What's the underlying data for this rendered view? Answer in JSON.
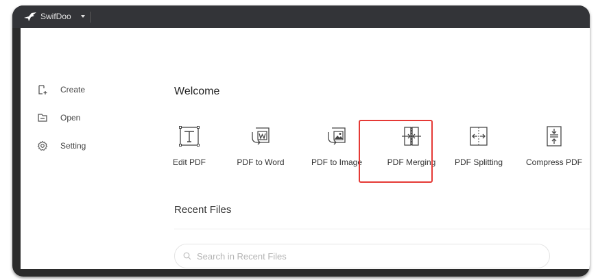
{
  "app": {
    "name": "SwifDoo"
  },
  "sidebar": {
    "items": [
      {
        "label": "Create",
        "icon": "create-icon"
      },
      {
        "label": "Open",
        "icon": "open-folder-icon"
      },
      {
        "label": "Setting",
        "icon": "gear-icon"
      }
    ]
  },
  "main": {
    "welcome": "Welcome",
    "tools": [
      {
        "label": "Edit PDF",
        "icon": "edit-text-icon"
      },
      {
        "label": "PDF to Word",
        "icon": "pdf-to-word-icon"
      },
      {
        "label": "PDF to Image",
        "icon": "pdf-to-image-icon"
      },
      {
        "label": "PDF Merging",
        "icon": "merge-icon",
        "highlighted": true
      },
      {
        "label": "PDF Splitting",
        "icon": "split-icon"
      },
      {
        "label": "Compress PDF",
        "icon": "compress-icon"
      }
    ],
    "recent_title": "Recent Files",
    "search_placeholder": "Search in Recent Files"
  },
  "colors": {
    "titlebar": "#333438",
    "frame": "#2b2b2b",
    "highlight": "#e53935"
  }
}
